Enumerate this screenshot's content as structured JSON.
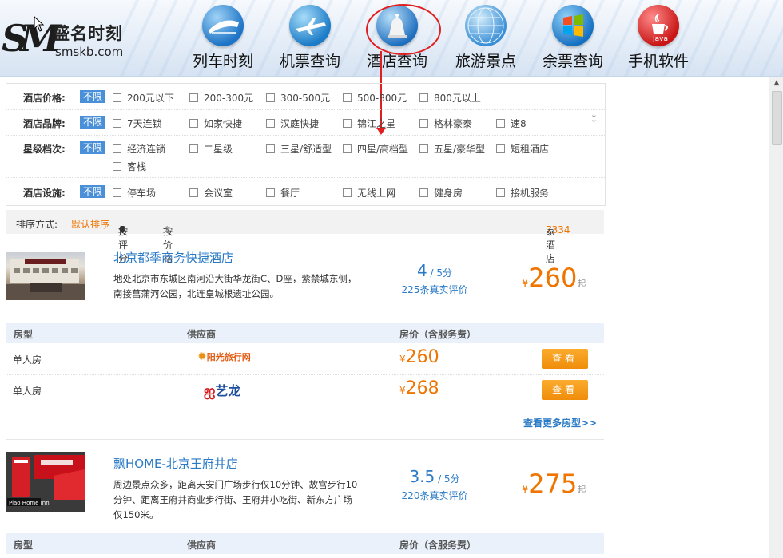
{
  "header": {
    "logo_mark": "SM",
    "logo_name": "盛名时刻",
    "logo_site": "smskb.com",
    "nav": [
      {
        "label": "列车时刻",
        "icon": "train-icon"
      },
      {
        "label": "机票查询",
        "icon": "airplane-icon"
      },
      {
        "label": "酒店查询",
        "icon": "hotel-icon"
      },
      {
        "label": "旅游景点",
        "icon": "globe-icon"
      },
      {
        "label": "余票查询",
        "icon": "windows-icon"
      },
      {
        "label": "手机软件",
        "icon": "java-icon"
      }
    ]
  },
  "filters": {
    "all_label": "不限",
    "rows": [
      {
        "label": "酒店价格:",
        "options": [
          "200元以下",
          "200-300元",
          "300-500元",
          "500-800元",
          "800元以上"
        ]
      },
      {
        "label": "酒店品牌:",
        "options": [
          "7天连锁",
          "如家快捷",
          "汉庭快捷",
          "锦江之星",
          "格林豪泰",
          "速8"
        ]
      },
      {
        "label": "星级档次:",
        "options": [
          "经济连锁",
          "二星级",
          "三星/舒适型",
          "四星/高档型",
          "五星/豪华型",
          "短租酒店",
          "客栈"
        ]
      },
      {
        "label": "酒店设施:",
        "options": [
          "停车场",
          "会议室",
          "餐厅",
          "无线上网",
          "健身房",
          "接机服务"
        ]
      }
    ]
  },
  "sort": {
    "label": "排序方式:",
    "default": "默认排序",
    "by_score": "按评分",
    "by_score_arrow": "🡇",
    "by_price": "按价格",
    "by_price_arrow": "⇕",
    "count": "7334",
    "count_suffix": "家酒店"
  },
  "hotels": [
    {
      "name": "北京都季商务快捷酒店",
      "desc": "地处北京市东城区南河沿大街华龙街C、D座，紫禁城东侧，南接菖蒲河公园，北连皇城根遗址公园。",
      "score": "4",
      "score_max": " / 5分",
      "reviews": "225条真实评价",
      "currency": "¥",
      "price": "260",
      "price_suffix": "起",
      "rooms_header": {
        "type": "房型",
        "supplier": "供应商",
        "price": "房价（含服务费）"
      },
      "rooms": [
        {
          "type": "单人房",
          "supplier": "阳光旅行网",
          "price": "260",
          "button": "查看"
        },
        {
          "type": "单人房",
          "supplier": "艺龙",
          "price": "268",
          "button": "查看"
        }
      ],
      "more_rooms": "查看更多房型>>"
    },
    {
      "name": "飘HOME-北京王府井店",
      "desc": "周边景点众多，距离天安门广场步行仅10分钟、故宫步行10分钟、距离王府井商业步行街、王府井小吃街、新东方广场仅150米。",
      "score": "3.5",
      "score_max": " / 5分",
      "reviews": "220条真实评价",
      "currency": "¥",
      "price": "275",
      "price_suffix": "起",
      "rooms_header": {
        "type": "房型",
        "supplier": "供应商",
        "price": "房价（含服务费）"
      }
    }
  ],
  "colors": {
    "accent": "#2a7ac6",
    "price": "#f07500",
    "annotation": "#e02020",
    "filter_all": "#4a90d9"
  }
}
